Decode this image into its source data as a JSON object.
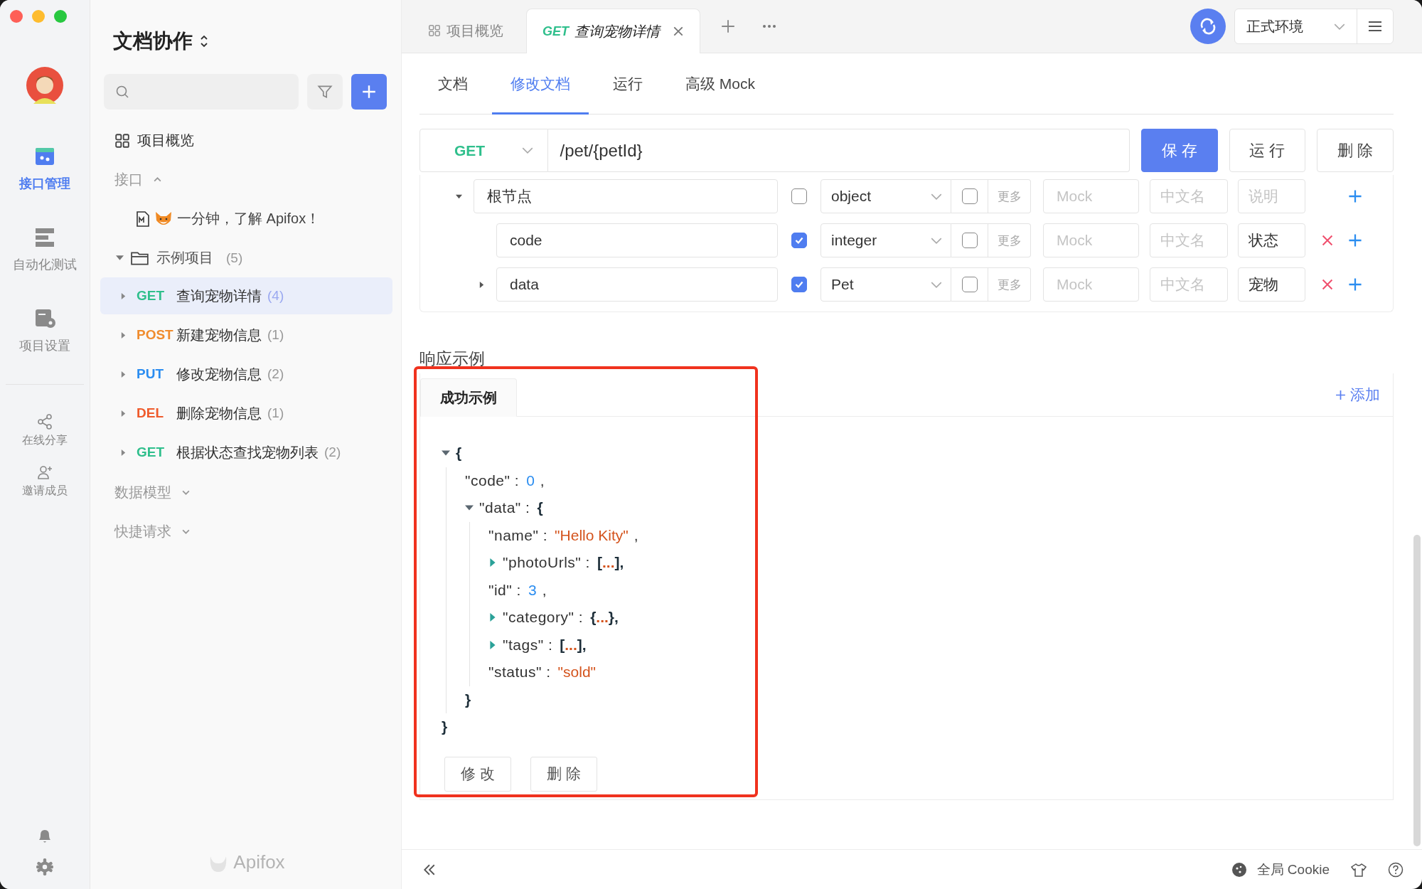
{
  "rail": {
    "items": [
      {
        "label": "接口管理",
        "selected": true
      },
      {
        "label": "自动化测试",
        "selected": false
      },
      {
        "label": "项目设置",
        "selected": false
      }
    ],
    "extras": [
      {
        "label": "在线分享"
      },
      {
        "label": "邀请成员"
      }
    ]
  },
  "sidebar": {
    "title": "文档协作",
    "overview": "项目概览",
    "sections": [
      {
        "label": "接口",
        "expanded": true,
        "items": [
          {
            "kind": "doc",
            "label": "一分钟，了解 Apifox！"
          },
          {
            "kind": "folder",
            "label": "示例项目",
            "count": "(5)",
            "expanded": true,
            "children": [
              {
                "method": "GET",
                "color": "#2fbf8c",
                "label": "查询宠物详情",
                "count": "(4)",
                "selected": true
              },
              {
                "method": "POST",
                "color": "#f08c2e",
                "label": "新建宠物信息",
                "count": "(1)",
                "selected": false
              },
              {
                "method": "PUT",
                "color": "#2b8df0",
                "label": "修改宠物信息",
                "count": "(2)",
                "selected": false
              },
              {
                "method": "DEL",
                "color": "#ef5b2c",
                "label": "删除宠物信息",
                "count": "(1)",
                "selected": false
              },
              {
                "method": "GET",
                "color": "#2fbf8c",
                "label": "根据状态查找宠物列表",
                "count": "(2)",
                "selected": false
              }
            ]
          }
        ]
      },
      {
        "label": "数据模型",
        "expanded": false
      },
      {
        "label": "快捷请求",
        "expanded": false
      }
    ],
    "brand": "Apifox"
  },
  "tabs": [
    {
      "kind": "overview",
      "label": "项目概览",
      "selected": false
    },
    {
      "kind": "request",
      "method": "GET",
      "color": "#2fbf8c",
      "label": "查询宠物详情",
      "selected": true,
      "closable": true
    }
  ],
  "environment": "正式环境",
  "doc_tabs": [
    {
      "label": "文档",
      "selected": false
    },
    {
      "label": "修改文档",
      "selected": true
    },
    {
      "label": "运行",
      "selected": false
    },
    {
      "label": "高级 Mock",
      "selected": false
    }
  ],
  "request": {
    "method": "GET",
    "path": "/pet/{petId}",
    "buttons": [
      {
        "label": "保 存",
        "primary": true
      },
      {
        "label": "运 行",
        "primary": false
      },
      {
        "label": "删 除",
        "primary": false
      }
    ]
  },
  "schema": [
    {
      "name": "根节点",
      "expanded": true,
      "required": false,
      "type": "object",
      "nullable": false,
      "more": "更多",
      "mock_placeholder": "Mock",
      "title_placeholder": "中文名",
      "desc_placeholder": "说明",
      "removable": false,
      "children": [
        {
          "name": "code",
          "required": true,
          "type": "integer",
          "nullable": false,
          "more": "更多",
          "mock_placeholder": "Mock",
          "title_placeholder": "中文名",
          "desc": "状态",
          "removable": true
        },
        {
          "name": "data",
          "expanded": false,
          "required": true,
          "type": "Pet",
          "nullable": false,
          "more": "更多",
          "mock_placeholder": "Mock",
          "title_placeholder": "中文名",
          "desc": "宠物",
          "removable": true
        }
      ]
    }
  ],
  "response": {
    "title": "响应示例",
    "add": "添加",
    "highlighted": true,
    "examples": [
      {
        "label": "成功示例",
        "selected": true
      }
    ],
    "json": {
      "open": "{",
      "close": "}",
      "expanded": true,
      "children": [
        {
          "key": "\"code\" :",
          "kind": "number",
          "value": "0",
          "comma": ","
        },
        {
          "key": "\"data\" :",
          "kind": "object",
          "expanded": true,
          "open": "{",
          "close": "}",
          "children": [
            {
              "key": "\"name\" :",
              "kind": "string",
              "value": "\"Hello Kity\"",
              "comma": ","
            },
            {
              "key": "\"photoUrls\" :",
              "kind": "object",
              "expanded": false,
              "open": "[",
              "dots": "...",
              "close": "],"
            },
            {
              "key": "\"id\" :",
              "kind": "number",
              "value": "3",
              "comma": ","
            },
            {
              "key": "\"category\" :",
              "kind": "object",
              "expanded": false,
              "open": "{",
              "dots": "...",
              "close": "},"
            },
            {
              "key": "\"tags\" :",
              "kind": "object",
              "expanded": false,
              "open": "[",
              "dots": "...",
              "close": "],"
            },
            {
              "key": "\"status\" :",
              "kind": "string",
              "value": "\"sold\""
            }
          ]
        }
      ]
    },
    "buttons": [
      "修 改",
      "删 除"
    ]
  },
  "status_bar": {
    "cookie": "全局 Cookie"
  }
}
